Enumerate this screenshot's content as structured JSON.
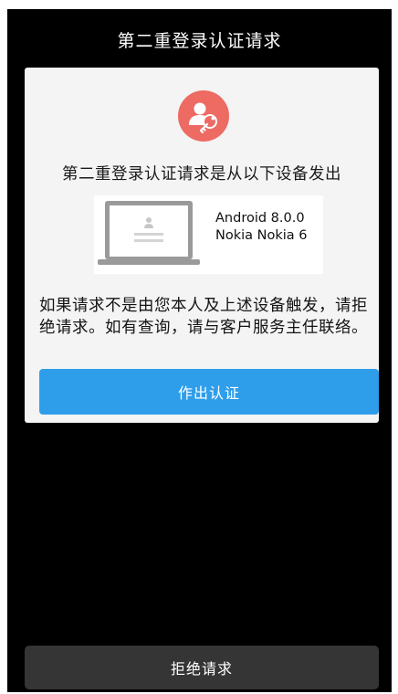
{
  "header": {
    "title": "第二重登录认证请求"
  },
  "card": {
    "icon": "user-key-icon",
    "heading": "第二重登录认证请求是从以下设备发出",
    "device": {
      "icon": "laptop-icon",
      "os": "Android 8.0.0",
      "model": "Nokia Nokia 6"
    },
    "warning": "如果请求不是由您本人及上述设备触发，请拒绝请求。如有查询，请与客户服务主任联络。",
    "confirm_label": "作出认证"
  },
  "footer": {
    "reject_label": "拒绝请求"
  },
  "colors": {
    "screen_background": "#000000",
    "card_background": "#f4f4f4",
    "icon_red": "#ed6b63",
    "confirm_blue": "#2f9eea",
    "reject_gray": "#353535"
  }
}
